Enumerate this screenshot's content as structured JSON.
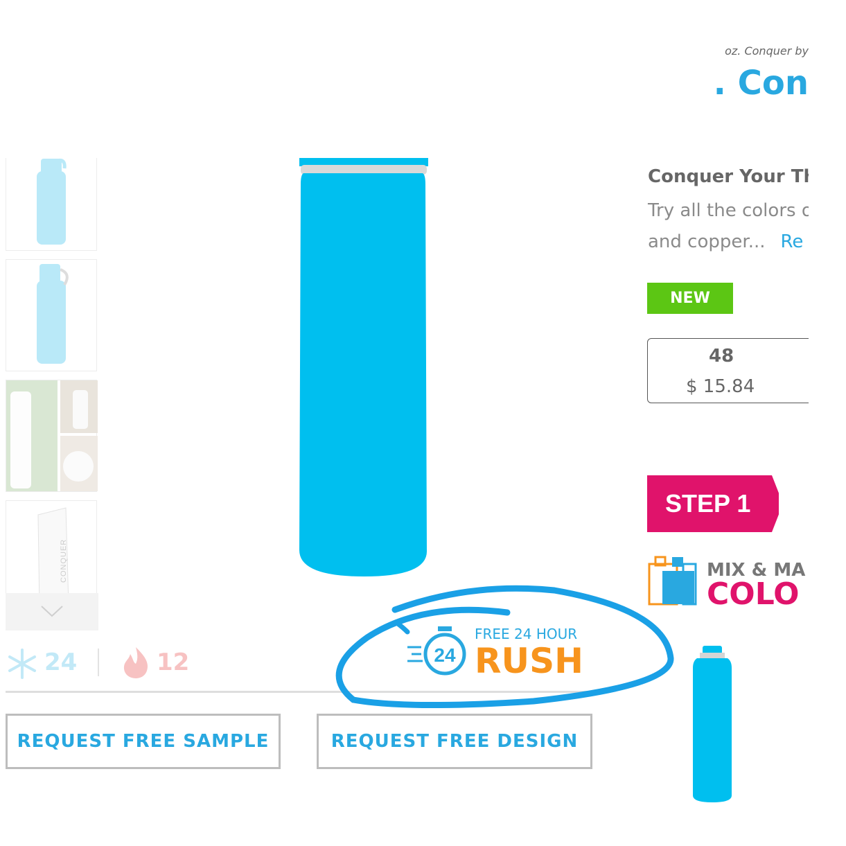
{
  "product": {
    "breadcrumb_fragment": "oz. Conquer by",
    "title_fragment": ". Con",
    "description_heading": "Conquer Your Th",
    "description_line1": "Try all the colors o",
    "description_line2": "and copper...",
    "read_more": "Re",
    "badge": "NEW",
    "price_tier": {
      "qty": "48",
      "price": "$ 15.84"
    },
    "color": "#00bfef"
  },
  "steps": {
    "step_label": "STEP 1"
  },
  "promo": {
    "mix_line1": "MIX & MA",
    "mix_line2": "COLO"
  },
  "stats": {
    "snow_count": "24",
    "fire_count": "12"
  },
  "rush": {
    "small": "FREE 24 HOUR",
    "big": "RUSH",
    "stopwatch": "24"
  },
  "actions": {
    "sample": "REQUEST FREE SAMPLE",
    "design": "REQUEST FREE DESIGN"
  },
  "colors": {
    "accent": "#29a8e0",
    "orange": "#f7941d",
    "pink": "#e0136b",
    "green": "#5cc614"
  }
}
